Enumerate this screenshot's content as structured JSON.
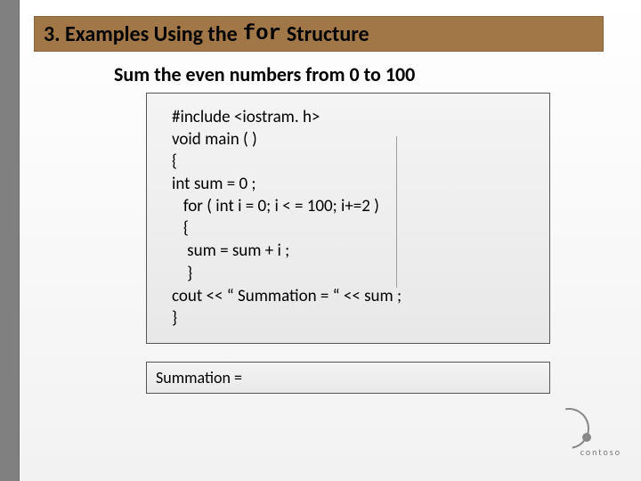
{
  "title": {
    "prefix": "3. Examples Using the",
    "mono": "for",
    "suffix": "Structure"
  },
  "subtitle": "Sum the even numbers from 0 to 100",
  "code": {
    "l1": "#include <iostram. h>",
    "l2": "void main ( )",
    "l3": "{",
    "l4": "int sum = 0 ;",
    "l5": "   for ( int i = 0; i < = 100; i+=2 )",
    "l6": "   {",
    "l7": "    sum = sum + i ;",
    "l8": "    }",
    "l9": "cout << “ Summation = “ << sum ;",
    "l10": "}"
  },
  "output": "Summation =",
  "logo_text": "contoso"
}
